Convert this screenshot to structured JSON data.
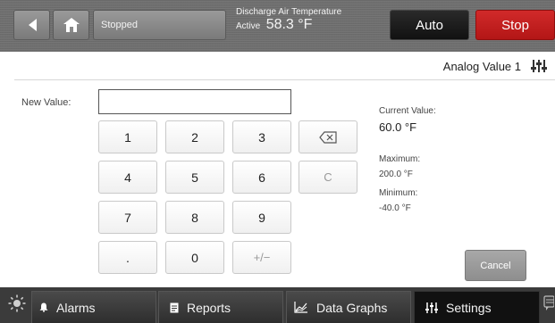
{
  "topbar": {
    "status": "Stopped",
    "discharge_label": "Discharge Air Temperature",
    "discharge_state": "Active",
    "discharge_value": "58.3 °F",
    "auto_label": "Auto",
    "stop_label": "Stop"
  },
  "header": {
    "title": "Analog Value 1"
  },
  "entry": {
    "new_value_label": "New Value:",
    "input_value": "",
    "keys": {
      "k1": "1",
      "k2": "2",
      "k3": "3",
      "k4": "4",
      "k5": "5",
      "k6": "6",
      "k7": "7",
      "k8": "8",
      "k9": "9",
      "dot": ".",
      "k0": "0",
      "plusminus": "+/−",
      "clear": "C"
    }
  },
  "info": {
    "current_label": "Current Value:",
    "current_value": "60.0 °F",
    "max_label": "Maximum:",
    "max_value": "200.0 °F",
    "min_label": "Minimum:",
    "min_value": "-40.0 °F"
  },
  "actions": {
    "cancel": "Cancel"
  },
  "nav": {
    "alarms": "Alarms",
    "reports": "Reports",
    "data_graphs": "Data Graphs",
    "settings": "Settings"
  },
  "colors": {
    "stop": "#c61f1f",
    "auto": "#1a1a1a",
    "topbar": "#6f6f6f",
    "bottombar": "#3b3b3b"
  }
}
